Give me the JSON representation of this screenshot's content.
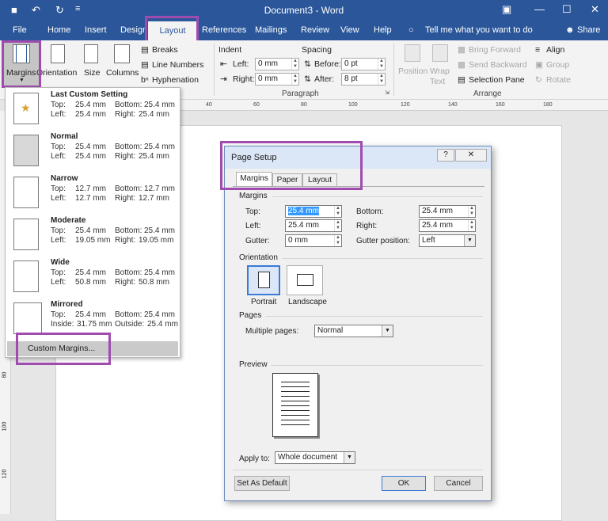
{
  "titlebar": {
    "title": "Document3 - Word",
    "minimize": "—",
    "maximize": "☐",
    "close": "✕",
    "save": "💾",
    "undo": "↶",
    "redo": "↻",
    "customize": "≡",
    "ribbon_display": "▣"
  },
  "tabs": {
    "file": "File",
    "home": "Home",
    "insert": "Insert",
    "design": "Design",
    "layout": "Layout",
    "references": "References",
    "mailings": "Mailings",
    "review": "Review",
    "view": "View",
    "help": "Help",
    "tell_me": "Tell me what you want to do",
    "share": "Share"
  },
  "ribbon": {
    "margins": "Margins",
    "orientation": "Orientation",
    "size": "Size",
    "columns": "Columns",
    "breaks": "Breaks",
    "line_numbers": "Line Numbers",
    "hyphenation": "Hyphenation",
    "indent": "Indent",
    "spacing": "Spacing",
    "left": "Left:",
    "right": "Right:",
    "before": "Before:",
    "after": "After:",
    "indent_left_val": "0 mm",
    "indent_right_val": "0 mm",
    "before_val": "0 pt",
    "after_val": "8 pt",
    "paragraph": "Paragraph",
    "position": "Position",
    "wrap_text": "Wrap Text",
    "bring_forward": "Bring Forward",
    "send_backward": "Send Backward",
    "selection_pane": "Selection Pane",
    "align": "Align",
    "group": "Group",
    "rotate": "Rotate",
    "arrange": "Arrange"
  },
  "ruler": {
    "ticks": [
      "40",
      "60",
      "80",
      "100",
      "120",
      "140",
      "160",
      "180"
    ]
  },
  "vruler": {
    "ticks": [
      "80",
      "100",
      "120"
    ]
  },
  "margins_menu": {
    "items": [
      {
        "name": "Last Custom Setting",
        "r1l": "Top:",
        "r1v": "25.4 mm",
        "r1rl": "Bottom:",
        "r1rv": "25.4 mm",
        "r2l": "Left:",
        "r2v": "25.4 mm",
        "r2rl": "Right:",
        "r2rv": "25.4 mm"
      },
      {
        "name": "Normal",
        "r1l": "Top:",
        "r1v": "25.4 mm",
        "r1rl": "Bottom:",
        "r1rv": "25.4 mm",
        "r2l": "Left:",
        "r2v": "25.4 mm",
        "r2rl": "Right:",
        "r2rv": "25.4 mm"
      },
      {
        "name": "Narrow",
        "r1l": "Top:",
        "r1v": "12.7 mm",
        "r1rl": "Bottom:",
        "r1rv": "12.7 mm",
        "r2l": "Left:",
        "r2v": "12.7 mm",
        "r2rl": "Right:",
        "r2rv": "12.7 mm"
      },
      {
        "name": "Moderate",
        "r1l": "Top:",
        "r1v": "25.4 mm",
        "r1rl": "Bottom:",
        "r1rv": "25.4 mm",
        "r2l": "Left:",
        "r2v": "19.05 mm",
        "r2rl": "Right:",
        "r2rv": "19.05 mm"
      },
      {
        "name": "Wide",
        "r1l": "Top:",
        "r1v": "25.4 mm",
        "r1rl": "Bottom:",
        "r1rv": "25.4 mm",
        "r2l": "Left:",
        "r2v": "50.8 mm",
        "r2rl": "Right:",
        "r2rv": "50.8 mm"
      },
      {
        "name": "Mirrored",
        "r1l": "Top:",
        "r1v": "25.4 mm",
        "r1rl": "Bottom:",
        "r1rv": "25.4 mm",
        "r2l": "Inside:",
        "r2v": "31.75 mm",
        "r2rl": "Outside:",
        "r2rv": "25.4 mm"
      }
    ],
    "custom": "Custom Margins..."
  },
  "dialog": {
    "title": "Page Setup",
    "help": "?",
    "close": "✕",
    "tab_margins": "Margins",
    "tab_paper": "Paper",
    "tab_layout": "Layout",
    "sec_margins": "Margins",
    "top": "Top:",
    "top_val": "25.4 mm",
    "bottom": "Bottom:",
    "bottom_val": "25.4 mm",
    "left": "Left:",
    "left_val": "25.4 mm",
    "right": "Right:",
    "right_val": "25.4 mm",
    "gutter": "Gutter:",
    "gutter_val": "0 mm",
    "gutter_pos": "Gutter position:",
    "gutter_pos_val": "Left",
    "sec_orientation": "Orientation",
    "portrait": "Portrait",
    "landscape": "Landscape",
    "sec_pages": "Pages",
    "multiple_pages": "Multiple pages:",
    "multiple_pages_val": "Normal",
    "sec_preview": "Preview",
    "apply_to": "Apply to:",
    "apply_to_val": "Whole document",
    "set_default": "Set As Default",
    "ok": "OK",
    "cancel": "Cancel"
  },
  "colors": {
    "accent": "#2b579a",
    "highlight": "#a04caf"
  }
}
